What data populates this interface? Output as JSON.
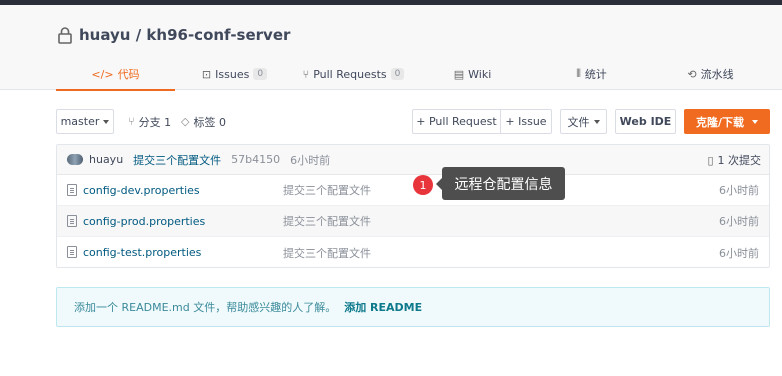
{
  "repo": {
    "owner": "huayu",
    "separator": " / ",
    "name": "kh96-conf-server"
  },
  "tabs": [
    {
      "label": "代码",
      "icon": "code-icon",
      "glyph": "</>",
      "count": ""
    },
    {
      "label": "Issues",
      "icon": "issues-icon",
      "glyph": "⊡",
      "count": "0"
    },
    {
      "label": "Pull Requests",
      "icon": "pull-request-icon",
      "glyph": "⑂",
      "count": "0"
    },
    {
      "label": "Wiki",
      "icon": "wiki-icon",
      "glyph": "▤",
      "count": ""
    },
    {
      "label": "统计",
      "icon": "stats-icon",
      "glyph": "⫴",
      "count": ""
    },
    {
      "label": "流水线",
      "icon": "pipeline-icon",
      "glyph": "⟲",
      "count": ""
    }
  ],
  "toolbar": {
    "branch": "master",
    "branches_label": "分支 1",
    "tags_label": "标签 0",
    "pull_request_label": "+ Pull Request",
    "issue_label": "+ Issue",
    "file_label": "文件",
    "webide_label": "Web IDE",
    "clone_label": "克隆/下载"
  },
  "commit": {
    "author": "huayu",
    "message": "提交三个配置文件",
    "sha": "57b4150",
    "time": "6小时前",
    "count_label": "1 次提交"
  },
  "files": [
    {
      "name": "config-dev.properties",
      "message": "提交三个配置文件",
      "time": "6小时前"
    },
    {
      "name": "config-prod.properties",
      "message": "提交三个配置文件",
      "time": "6小时前"
    },
    {
      "name": "config-test.properties",
      "message": "提交三个配置文件",
      "time": "6小时前"
    }
  ],
  "tooltip": {
    "badge": "1",
    "text": "远程仓配置信息"
  },
  "readme": {
    "text": "添加一个 README.md 文件，帮助感兴趣的人了解。",
    "link": "添加 README"
  },
  "colors": {
    "accent": "#f06b1f",
    "link": "#005980",
    "badge": "#e8353c"
  }
}
